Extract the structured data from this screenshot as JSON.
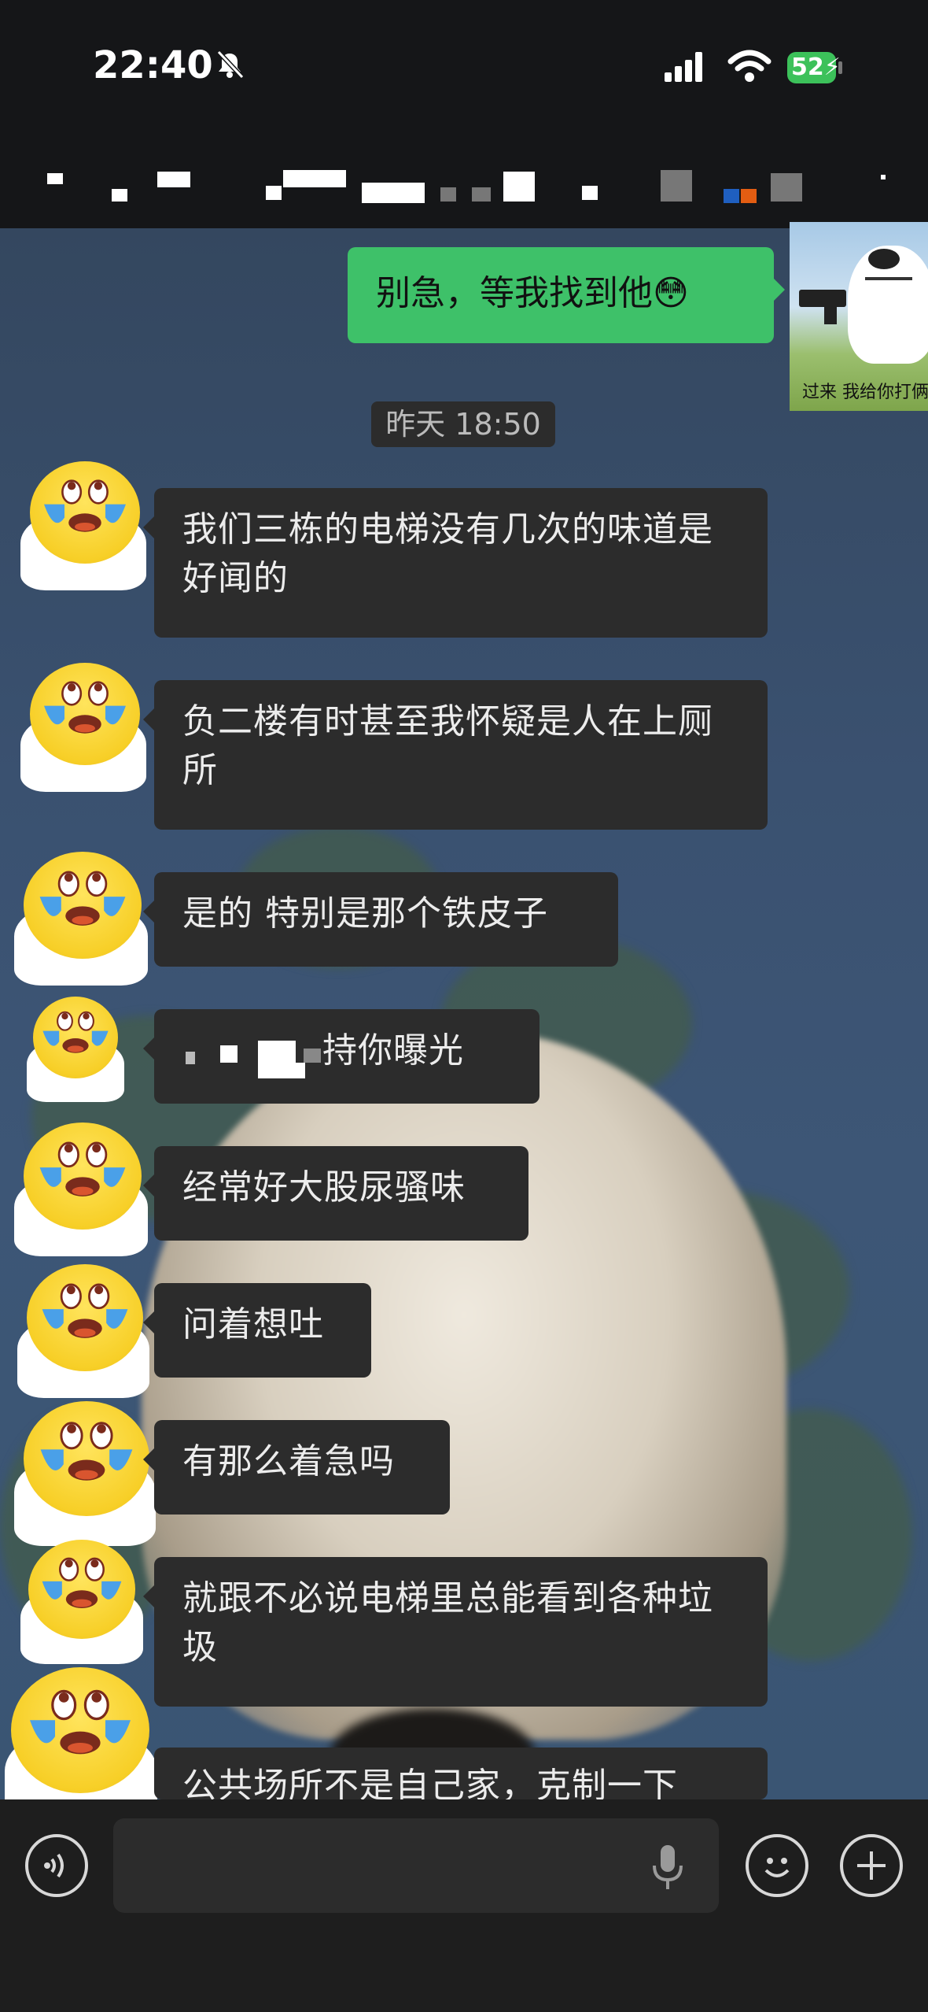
{
  "status_bar": {
    "time": "22:40",
    "battery": "52"
  },
  "messages": [
    {
      "text": "我们三栋的电梯没有几次的味道是好闻的"
    },
    {
      "text": "负二楼有时甚至我怀疑是人在上厕所"
    },
    {
      "text": "是的 特别是那个铁皮子"
    },
    {
      "text": "持你曝光"
    },
    {
      "text": "经常好大股尿骚味"
    },
    {
      "text": "问着想吐"
    },
    {
      "text": "有那么着急吗"
    },
    {
      "text": "就跟不必说电梯里总能看到各种垃圾"
    },
    {
      "text": "公共场所不是自己家，克制一下"
    }
  ],
  "my_message": {
    "text": "别急，等我找到他",
    "emoji": "😳"
  },
  "sticker": {
    "caption": "过来 我给你打俩"
  },
  "timestamp": "昨天 18:50",
  "icons": {
    "mute": "bell-slash-icon",
    "voice": "voice-icon",
    "mic": "mic-icon",
    "emoji": "smile-icon",
    "add": "plus-icon"
  }
}
